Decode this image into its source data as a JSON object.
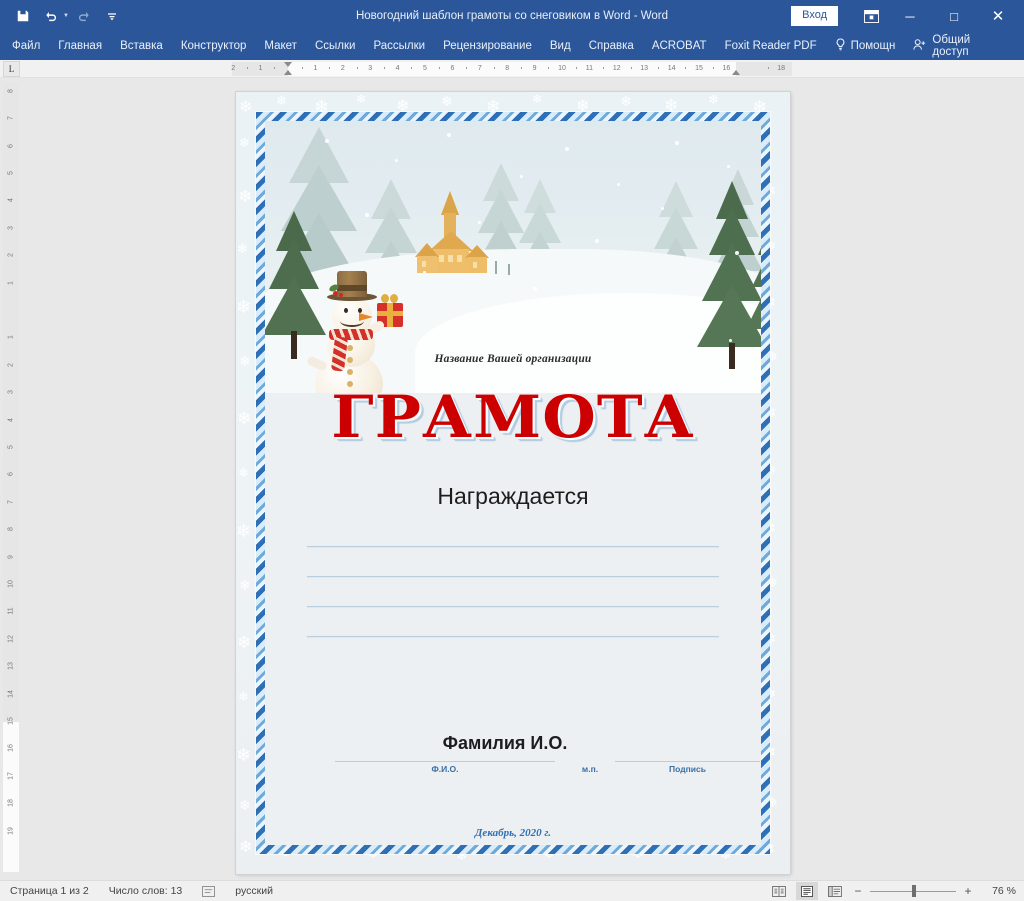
{
  "window": {
    "title": "Новогодний шаблон грамоты со снеговиком в Word  -  Word",
    "signin_label": "Вход",
    "quick_access": [
      {
        "name": "save-icon",
        "glyph": "💾"
      },
      {
        "name": "undo-icon",
        "glyph": "↶"
      },
      {
        "name": "redo-icon",
        "glyph": "↷"
      },
      {
        "name": "customize-qat-icon",
        "glyph": "☰"
      }
    ],
    "controls": {
      "ribbon_display": "ribbon-display-options-icon",
      "minimize": "─",
      "maximize": "□",
      "close": "✕"
    }
  },
  "ribbon": {
    "tabs": [
      "Файл",
      "Главная",
      "Вставка",
      "Конструктор",
      "Макет",
      "Ссылки",
      "Рассылки",
      "Рецензирование",
      "Вид",
      "Справка",
      "ACROBAT",
      "Foxit Reader PDF"
    ],
    "tellme": "Помощн",
    "share": "Общий доступ"
  },
  "ruler": {
    "tabstop_marker": "L",
    "horizontal_labels": [
      "2",
      "1",
      "1",
      "2",
      "3",
      "4",
      "5",
      "6",
      "7",
      "8",
      "9",
      "10",
      "11",
      "12",
      "13",
      "14",
      "15",
      "16",
      "18"
    ],
    "vertical_labels": [
      "8",
      "7",
      "6",
      "5",
      "4",
      "3",
      "2",
      "1",
      "1",
      "2",
      "3",
      "4",
      "5",
      "6",
      "7",
      "8",
      "9",
      "10",
      "11",
      "12",
      "13",
      "14",
      "15",
      "16",
      "17",
      "18",
      "19"
    ]
  },
  "document": {
    "organization": "Название Вашей организации",
    "title": "ГРАМОТА",
    "awarded_label": "Награждается",
    "blank_lines": 4,
    "signature": {
      "name": "Фамилия И.О.",
      "caption_fio": "Ф.И.О.",
      "caption_stamp": "м.п.",
      "caption_sign": "Подпись",
      "date": "Декабрь, 2020 г."
    },
    "colors": {
      "title_red": "#cc0000",
      "frame_blue": "#2f6fb5",
      "line_blue": "#b9cfdf",
      "caption_blue": "#3a6ea5"
    }
  },
  "status": {
    "page": "Страница 1 из 2",
    "words": "Число слов: 13",
    "proofing_icon": "proofing-errors-icon",
    "language": "русский",
    "views": [
      "read-mode-icon",
      "print-layout-icon",
      "web-layout-icon"
    ],
    "zoom_out": "−",
    "zoom_in": "+",
    "zoom_percent": "76 %"
  }
}
